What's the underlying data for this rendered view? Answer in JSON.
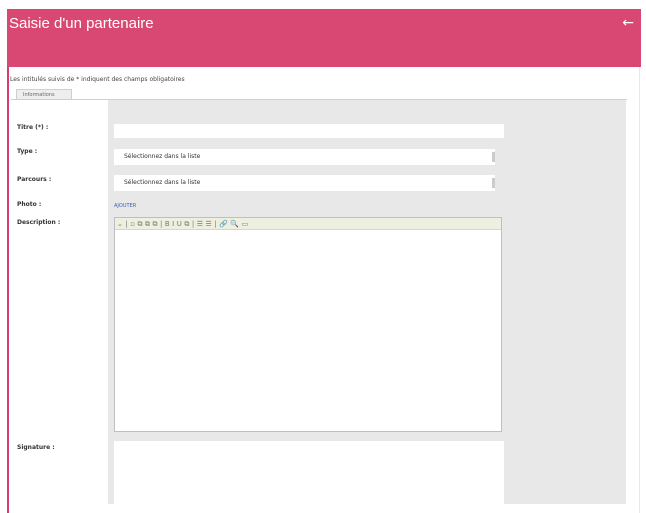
{
  "header": {
    "title": "Saisie d'un partenaire",
    "back_icon": "←"
  },
  "intro_text": "Les intitulés suivis de * indiquent des champs obligatoires",
  "tab_label": "Informations",
  "fields": {
    "titre_label": "Titre (*) :",
    "titre_value": "",
    "type_label": "Type :",
    "type_value": "Sélectionnez dans la liste",
    "parcours_label": "Parcours :",
    "parcours_value": "Sélectionnez dans la liste",
    "photo_label": "Photo :",
    "photo_link": "AJOUTER",
    "description_label": "Description :",
    "signature_label": "Signature :"
  },
  "toolbar": {
    "items": [
      "⌄",
      "|",
      "▫",
      "⧉",
      "⧉",
      "⧉",
      "|",
      "B",
      "I",
      "U",
      "⧉",
      "|",
      "☰",
      "☰",
      "|",
      "🔗",
      "🔍",
      "▭"
    ]
  }
}
